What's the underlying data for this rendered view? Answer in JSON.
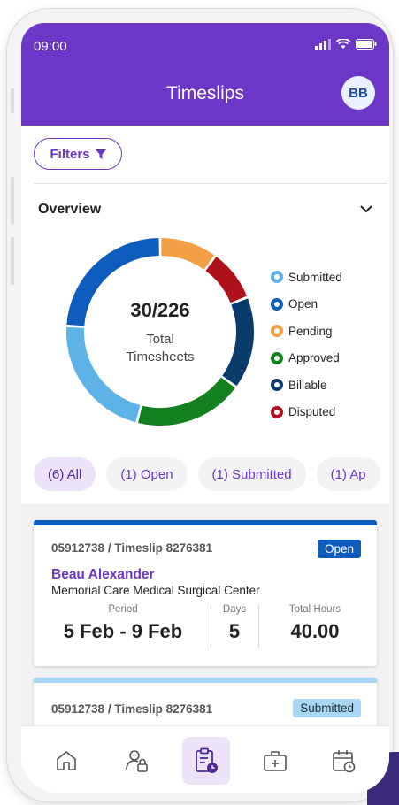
{
  "status_bar": {
    "time": "09:00"
  },
  "header": {
    "title": "Timeslips",
    "avatar_initials": "BB"
  },
  "filters": {
    "label": "Filters"
  },
  "overview": {
    "title": "Overview",
    "total_value": "30/226",
    "total_label_line1": "Total",
    "total_label_line2": "Timesheets",
    "legend": [
      {
        "label": "Submitted",
        "color": "#5db3e8"
      },
      {
        "label": "Open",
        "color": "#0f5cbf"
      },
      {
        "label": "Pending",
        "color": "#f29f45"
      },
      {
        "label": "Approved",
        "color": "#13811f"
      },
      {
        "label": "Billable",
        "color": "#0a3c6b"
      },
      {
        "label": "Disputed",
        "color": "#b0121b"
      }
    ]
  },
  "chart_data": {
    "type": "pie",
    "categories": [
      "Pending",
      "Disputed",
      "Billable",
      "Approved",
      "Submitted",
      "Open"
    ],
    "values": [
      10,
      9,
      16,
      19,
      22,
      24
    ],
    "colors": [
      "#f29f45",
      "#b0121b",
      "#0a3c6b",
      "#13811f",
      "#5db3e8",
      "#0f5cbf"
    ]
  },
  "chips": [
    {
      "label": "(6) All",
      "active": true
    },
    {
      "label": "(1) Open",
      "active": false
    },
    {
      "label": "(1) Submitted",
      "active": false
    },
    {
      "label": "(1) Ap",
      "active": false
    }
  ],
  "cards": [
    {
      "id": "05912738 / Timeslip 8276381",
      "status": "Open",
      "status_color": "#0f5cbf",
      "name": "Beau Alexander",
      "location": "Memorial Care Medical Surgical Center",
      "period_label": "Period",
      "period_value": "5 Feb - 9 Feb",
      "days_label": "Days",
      "days_value": "5",
      "hours_label": "Total Hours",
      "hours_value": "40.00"
    },
    {
      "id": "05912738 / Timeslip 8276381",
      "status": "Submitted",
      "status_color": "#a8d7f4"
    }
  ],
  "nav": [
    {
      "icon": "home-icon"
    },
    {
      "icon": "user-lock-icon"
    },
    {
      "icon": "timesheet-clipboard-icon",
      "active": true
    },
    {
      "icon": "medical-briefcase-icon"
    },
    {
      "icon": "calendar-history-icon"
    }
  ]
}
